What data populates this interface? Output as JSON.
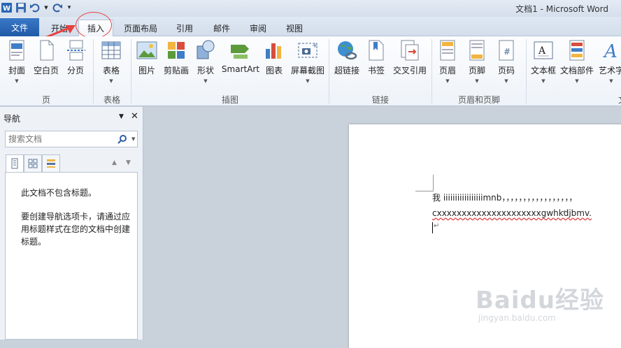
{
  "title_bar": {
    "doc_title": "文档1 - Microsoft Word"
  },
  "tabs": {
    "file": "文件",
    "items": [
      "开始",
      "插入",
      "页面布局",
      "引用",
      "邮件",
      "审阅",
      "视图"
    ],
    "active": "插入"
  },
  "ribbon": {
    "groups": {
      "pages": {
        "label": "页",
        "buttons": [
          "封面",
          "空白页",
          "分页"
        ]
      },
      "tables": {
        "label": "表格",
        "buttons": [
          "表格"
        ]
      },
      "illustrations": {
        "label": "插图",
        "buttons": [
          "图片",
          "剪贴画",
          "形状",
          "SmartArt",
          "图表",
          "屏幕截图"
        ]
      },
      "links": {
        "label": "链接",
        "buttons": [
          "超链接",
          "书签",
          "交叉引用"
        ]
      },
      "header_footer": {
        "label": "页眉和页脚",
        "buttons": [
          "页眉",
          "页脚",
          "页码"
        ]
      },
      "text": {
        "label": "文",
        "buttons": [
          "文本框",
          "文档部件",
          "艺术字"
        ]
      }
    }
  },
  "nav": {
    "title": "导航",
    "search_placeholder": "搜索文档",
    "messages": [
      "此文档不包含标题。",
      "要创建导航选项卡，请通过应用标题样式在您的文档中创建标题。"
    ]
  },
  "document": {
    "line1": "我  iiiiiiiiiiiiiiiiimnb，，，，，，，，，，，，，，，，，",
    "line2": "cxxxxxxxxxxxxxxxxxxxxxgwhkdjbmv."
  },
  "watermark": {
    "text": "Baidu经验",
    "sub": "jingyan.baidu.com"
  },
  "colors": {
    "file_tab": "#2a66b5",
    "annotation": "#e8403e",
    "accent": "#3a79c7"
  }
}
